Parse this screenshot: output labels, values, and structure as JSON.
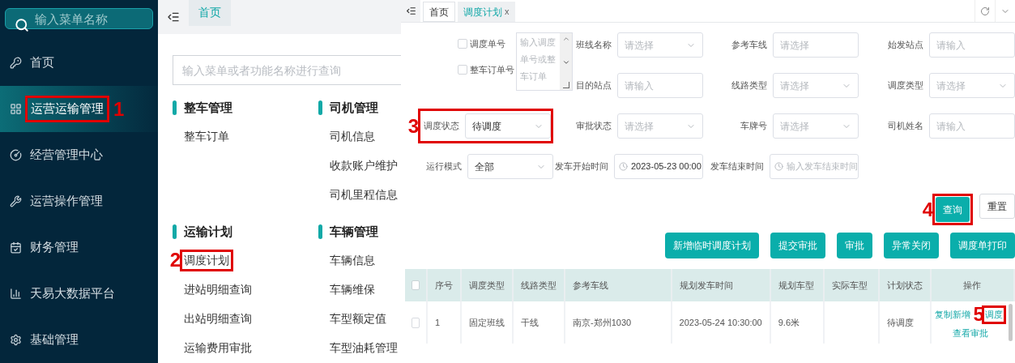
{
  "sidebar": {
    "search": {
      "placeholder": "输入菜单名称"
    },
    "items": [
      {
        "label": "首页",
        "selected": false
      },
      {
        "label": "运营运输管理",
        "selected": true,
        "callout": "1"
      },
      {
        "label": "经营管理中心",
        "selected": false
      },
      {
        "label": "运营操作管理",
        "selected": false
      },
      {
        "label": "财务管理",
        "selected": false
      },
      {
        "label": "天易大数据平台",
        "selected": false
      },
      {
        "label": "基础管理",
        "selected": false
      }
    ]
  },
  "menu_panel": {
    "tabs": [
      {
        "label": "首页",
        "selected": true
      }
    ],
    "search": {
      "placeholder": "输入菜单或者功能名称进行查询"
    },
    "columns": [
      {
        "groups": [
          {
            "title": "整车管理",
            "items": [
              {
                "label": "整车订单"
              }
            ]
          },
          {
            "title": "运输计划",
            "items": [
              {
                "label": "调度计划",
                "callout": "2"
              },
              {
                "label": "进站明细查询"
              },
              {
                "label": "出站明细查询"
              },
              {
                "label": "运输费用审批"
              }
            ]
          }
        ]
      },
      {
        "groups": [
          {
            "title": "司机管理",
            "items": [
              {
                "label": "司机信息"
              },
              {
                "label": "收款账户维护"
              },
              {
                "label": "司机里程信息"
              }
            ]
          },
          {
            "title": "车辆管理",
            "items": [
              {
                "label": "车辆信息"
              },
              {
                "label": "车辆维保"
              },
              {
                "label": "车型额定值"
              },
              {
                "label": "车型油耗管理"
              }
            ]
          }
        ]
      }
    ]
  },
  "app": {
    "tabs": [
      {
        "label": "首页",
        "selected": false
      },
      {
        "label": "调度计划",
        "selected": true,
        "close": "x"
      }
    ],
    "filters": [
      {
        "kind": "number_search",
        "options": [
          {
            "label": "调度单号",
            "checked": false
          },
          {
            "label": "整车订单号",
            "checked": false
          }
        ],
        "placeholder": "输入调度单号或整车订单"
      },
      {
        "label": "班线名称",
        "kind": "select",
        "placeholder": "请选择"
      },
      {
        "label": "参考车线",
        "kind": "input",
        "placeholder": "请选择"
      },
      {
        "label": "始发站点",
        "kind": "input",
        "placeholder": "请输入"
      },
      {
        "label": "目的站点",
        "kind": "input",
        "placeholder": "请输入"
      },
      {
        "label": "线路类型",
        "kind": "select",
        "placeholder": "请选择"
      },
      {
        "label": "调度类型",
        "kind": "select",
        "placeholder": "请选择"
      },
      {
        "label": "调度状态",
        "kind": "select",
        "value": "待调度",
        "callout": "3"
      },
      {
        "label": "审批状态",
        "kind": "select",
        "placeholder": "请选择"
      },
      {
        "label": "车牌号",
        "kind": "select",
        "placeholder": "请选择"
      },
      {
        "label": "司机姓名",
        "kind": "input",
        "placeholder": "请输入"
      },
      {
        "label": "运行模式",
        "kind": "select",
        "value": "全部"
      },
      {
        "label": "发车开始时间",
        "kind": "date",
        "value": "2023-05-23 00:00"
      },
      {
        "label": "发车结束时间",
        "kind": "date",
        "placeholder": "输入发车结束时间"
      }
    ],
    "query_buttons": [
      {
        "label": "查询",
        "kind": "primary",
        "callout": "4"
      },
      {
        "label": "重置",
        "kind": "default"
      }
    ],
    "action_buttons": [
      {
        "label": "新增临时调度计划"
      },
      {
        "label": "提交审批"
      },
      {
        "label": "审批"
      },
      {
        "label": "异常关闭"
      },
      {
        "label": "调度单打印"
      }
    ],
    "table": {
      "select_all_checked": false,
      "columns": [
        "序号",
        "调度类型",
        "线路类型",
        "参考车线",
        "规划发车时间",
        "规划车型",
        "实际车型",
        "计划状态",
        "操作"
      ],
      "rows": [
        {
          "checked": false,
          "cells": [
            "1",
            "固定班线",
            "干线",
            "南京-郑州1030",
            "2023-05-24 10:30:00",
            "9.6米",
            null,
            "待调度"
          ],
          "actions": [
            {
              "label": "复制新增"
            },
            {
              "label": "调度",
              "callout": "5"
            },
            {
              "label": "查看审批"
            }
          ]
        }
      ]
    }
  }
}
